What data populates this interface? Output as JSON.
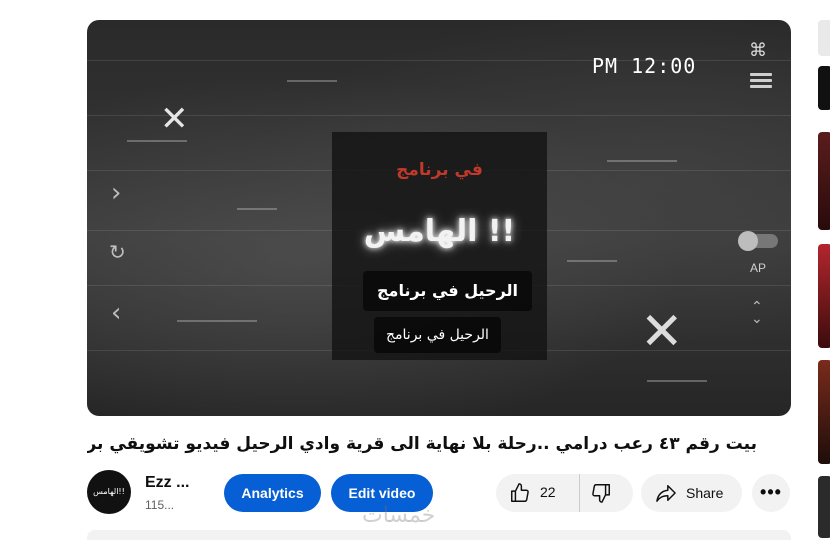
{
  "player": {
    "timestamp": "PM 12:00",
    "program_label": "في برنامج",
    "show_title": "الهامس !!",
    "caption_primary": "الرحيل في برنامج",
    "caption_secondary": "الرحيل في برنامج",
    "autoplay_label": "AP",
    "icons": [
      "capcut-icon",
      "menu-icon",
      "chevron-right-icon",
      "replay-icon",
      "chevron-left-icon",
      "close-icon",
      "autoplay-toggle",
      "expand-icon"
    ]
  },
  "video": {
    "title": "بيت رقم ٤٣ رعب درامي ..رحلة بلا نهاية الى قرية وادي الرحيل فيديو تشويقي برنامج الهامس"
  },
  "channel": {
    "avatar_text": "الهامس!!",
    "name": "Ezz ...",
    "subscribers": "115..."
  },
  "actions": {
    "analytics_label": "Analytics",
    "edit_label": "Edit video",
    "like_count": "22",
    "share_label": "Share",
    "more_label": "•••"
  },
  "watermark": "خمسات",
  "colors": {
    "accent_blue": "#065fd4",
    "pill_bg": "#f2f2f2",
    "program_red": "#c0392b"
  }
}
